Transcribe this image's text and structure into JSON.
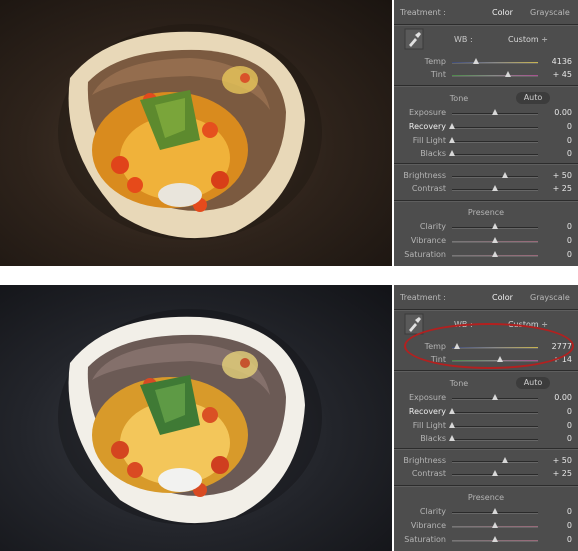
{
  "screens": [
    {
      "treatment": {
        "label": "Treatment :",
        "color": "Color",
        "grayscale": "Grayscale"
      },
      "wb": {
        "label": "WB :",
        "value": "Custom ÷"
      },
      "temp": {
        "label": "Temp",
        "value": "4136",
        "level": 0.28
      },
      "tint": {
        "label": "Tint",
        "value": "+ 45",
        "level": 0.65
      },
      "tone": {
        "title": "Tone",
        "auto": "Auto"
      },
      "exposure": {
        "label": "Exposure",
        "value": "0.00",
        "level": 0.5
      },
      "recovery": {
        "label": "Recovery",
        "value": "0",
        "level": 0.0
      },
      "fill_light": {
        "label": "Fill Light",
        "value": "0",
        "level": 0.0
      },
      "blacks": {
        "label": "Blacks",
        "value": "0",
        "level": 0.0
      },
      "brightness": {
        "label": "Brightness",
        "value": "+ 50",
        "level": 0.62
      },
      "contrast": {
        "label": "Contrast",
        "value": "+ 25",
        "level": 0.5
      },
      "presence": {
        "title": "Presence"
      },
      "clarity": {
        "label": "Clarity",
        "value": "0",
        "level": 0.5
      },
      "vibrance": {
        "label": "Vibrance",
        "value": "0",
        "level": 0.5
      },
      "saturation": {
        "label": "Saturation",
        "value": "0",
        "level": 0.5
      }
    },
    {
      "treatment": {
        "label": "Treatment :",
        "color": "Color",
        "grayscale": "Grayscale"
      },
      "wb": {
        "label": "WB :",
        "value": "Custom ÷"
      },
      "temp": {
        "label": "Temp",
        "value": "2777",
        "level": 0.06
      },
      "tint": {
        "label": "Tint",
        "value": "+ 14",
        "level": 0.56
      },
      "tone": {
        "title": "Tone",
        "auto": "Auto"
      },
      "exposure": {
        "label": "Exposure",
        "value": "0.00",
        "level": 0.5
      },
      "recovery": {
        "label": "Recovery",
        "value": "0",
        "level": 0.0
      },
      "fill_light": {
        "label": "Fill Light",
        "value": "0",
        "level": 0.0
      },
      "blacks": {
        "label": "Blacks",
        "value": "0",
        "level": 0.0
      },
      "brightness": {
        "label": "Brightness",
        "value": "+ 50",
        "level": 0.62
      },
      "contrast": {
        "label": "Contrast",
        "value": "+ 25",
        "level": 0.5
      },
      "presence": {
        "title": "Presence"
      },
      "clarity": {
        "label": "Clarity",
        "value": "0",
        "level": 0.5
      },
      "vibrance": {
        "label": "Vibrance",
        "value": "0",
        "level": 0.5
      },
      "saturation": {
        "label": "Saturation",
        "value": "0",
        "level": 0.5
      }
    }
  ],
  "icons": {
    "eyedropper": "eyedropper-icon"
  },
  "colors": {
    "highlight": "#b3201f",
    "panel_bg": "#4d4d4d"
  }
}
